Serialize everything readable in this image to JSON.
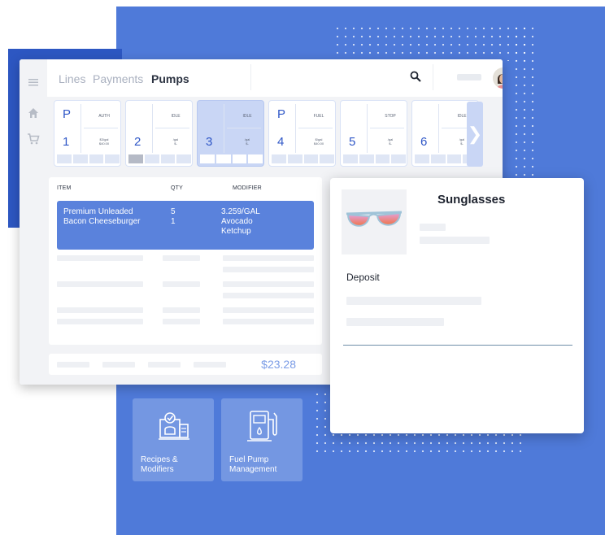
{
  "nav": {
    "tabs": [
      {
        "label": "Lines",
        "active": false
      },
      {
        "label": "Payments",
        "active": false
      },
      {
        "label": "Pumps",
        "active": true
      }
    ]
  },
  "sidebar": {
    "icons": [
      "menu-icon",
      "home-icon",
      "cart-icon"
    ]
  },
  "pumps": [
    {
      "letter": "P",
      "number": "1",
      "status": "AUTH",
      "price_line1": "$3/gal",
      "price_line2": "$40.00",
      "selected": false
    },
    {
      "letter": "",
      "number": "2",
      "status": "IDLE",
      "price_line1": "/gal",
      "price_line2": "$-",
      "selected": false
    },
    {
      "letter": "",
      "number": "3",
      "status": "IDLE",
      "price_line1": "/gal",
      "price_line2": "$-",
      "selected": true
    },
    {
      "letter": "P",
      "number": "4",
      "status": "FUEL",
      "price_line1": "$/gal",
      "price_line2": "$40.00",
      "selected": false
    },
    {
      "letter": "",
      "number": "5",
      "status": "STOP",
      "price_line1": "/gal",
      "price_line2": "$-",
      "selected": false
    },
    {
      "letter": "",
      "number": "6",
      "status": "IDLE",
      "price_line1": "/gal",
      "price_line2": "$-",
      "selected": false
    }
  ],
  "order": {
    "columns": [
      "ITEM",
      "QTY",
      "MODIFIER"
    ],
    "selected_rows": {
      "items": [
        "Premium Unleaded",
        "Bacon Cheeseburger"
      ],
      "qtys": [
        "5",
        "1"
      ],
      "modifiers": [
        "3.259/GAL",
        "Avocado",
        "Ketchup"
      ]
    },
    "total": "$23.28"
  },
  "product": {
    "title": "Sunglasses",
    "label": "Deposit"
  },
  "tiles": [
    {
      "label_line1": "Recipes &",
      "label_line2": "Modifiers",
      "icon": "recipe-icon"
    },
    {
      "label_line1": "Fuel Pump",
      "label_line2": "Management",
      "icon": "fuel-pump-icon"
    }
  ],
  "colors": {
    "brand_blue": "#4f7ad9",
    "dark_blue": "#2d57c2",
    "selection_blue": "#5a82dc",
    "total_blue": "#7b9ce6"
  }
}
